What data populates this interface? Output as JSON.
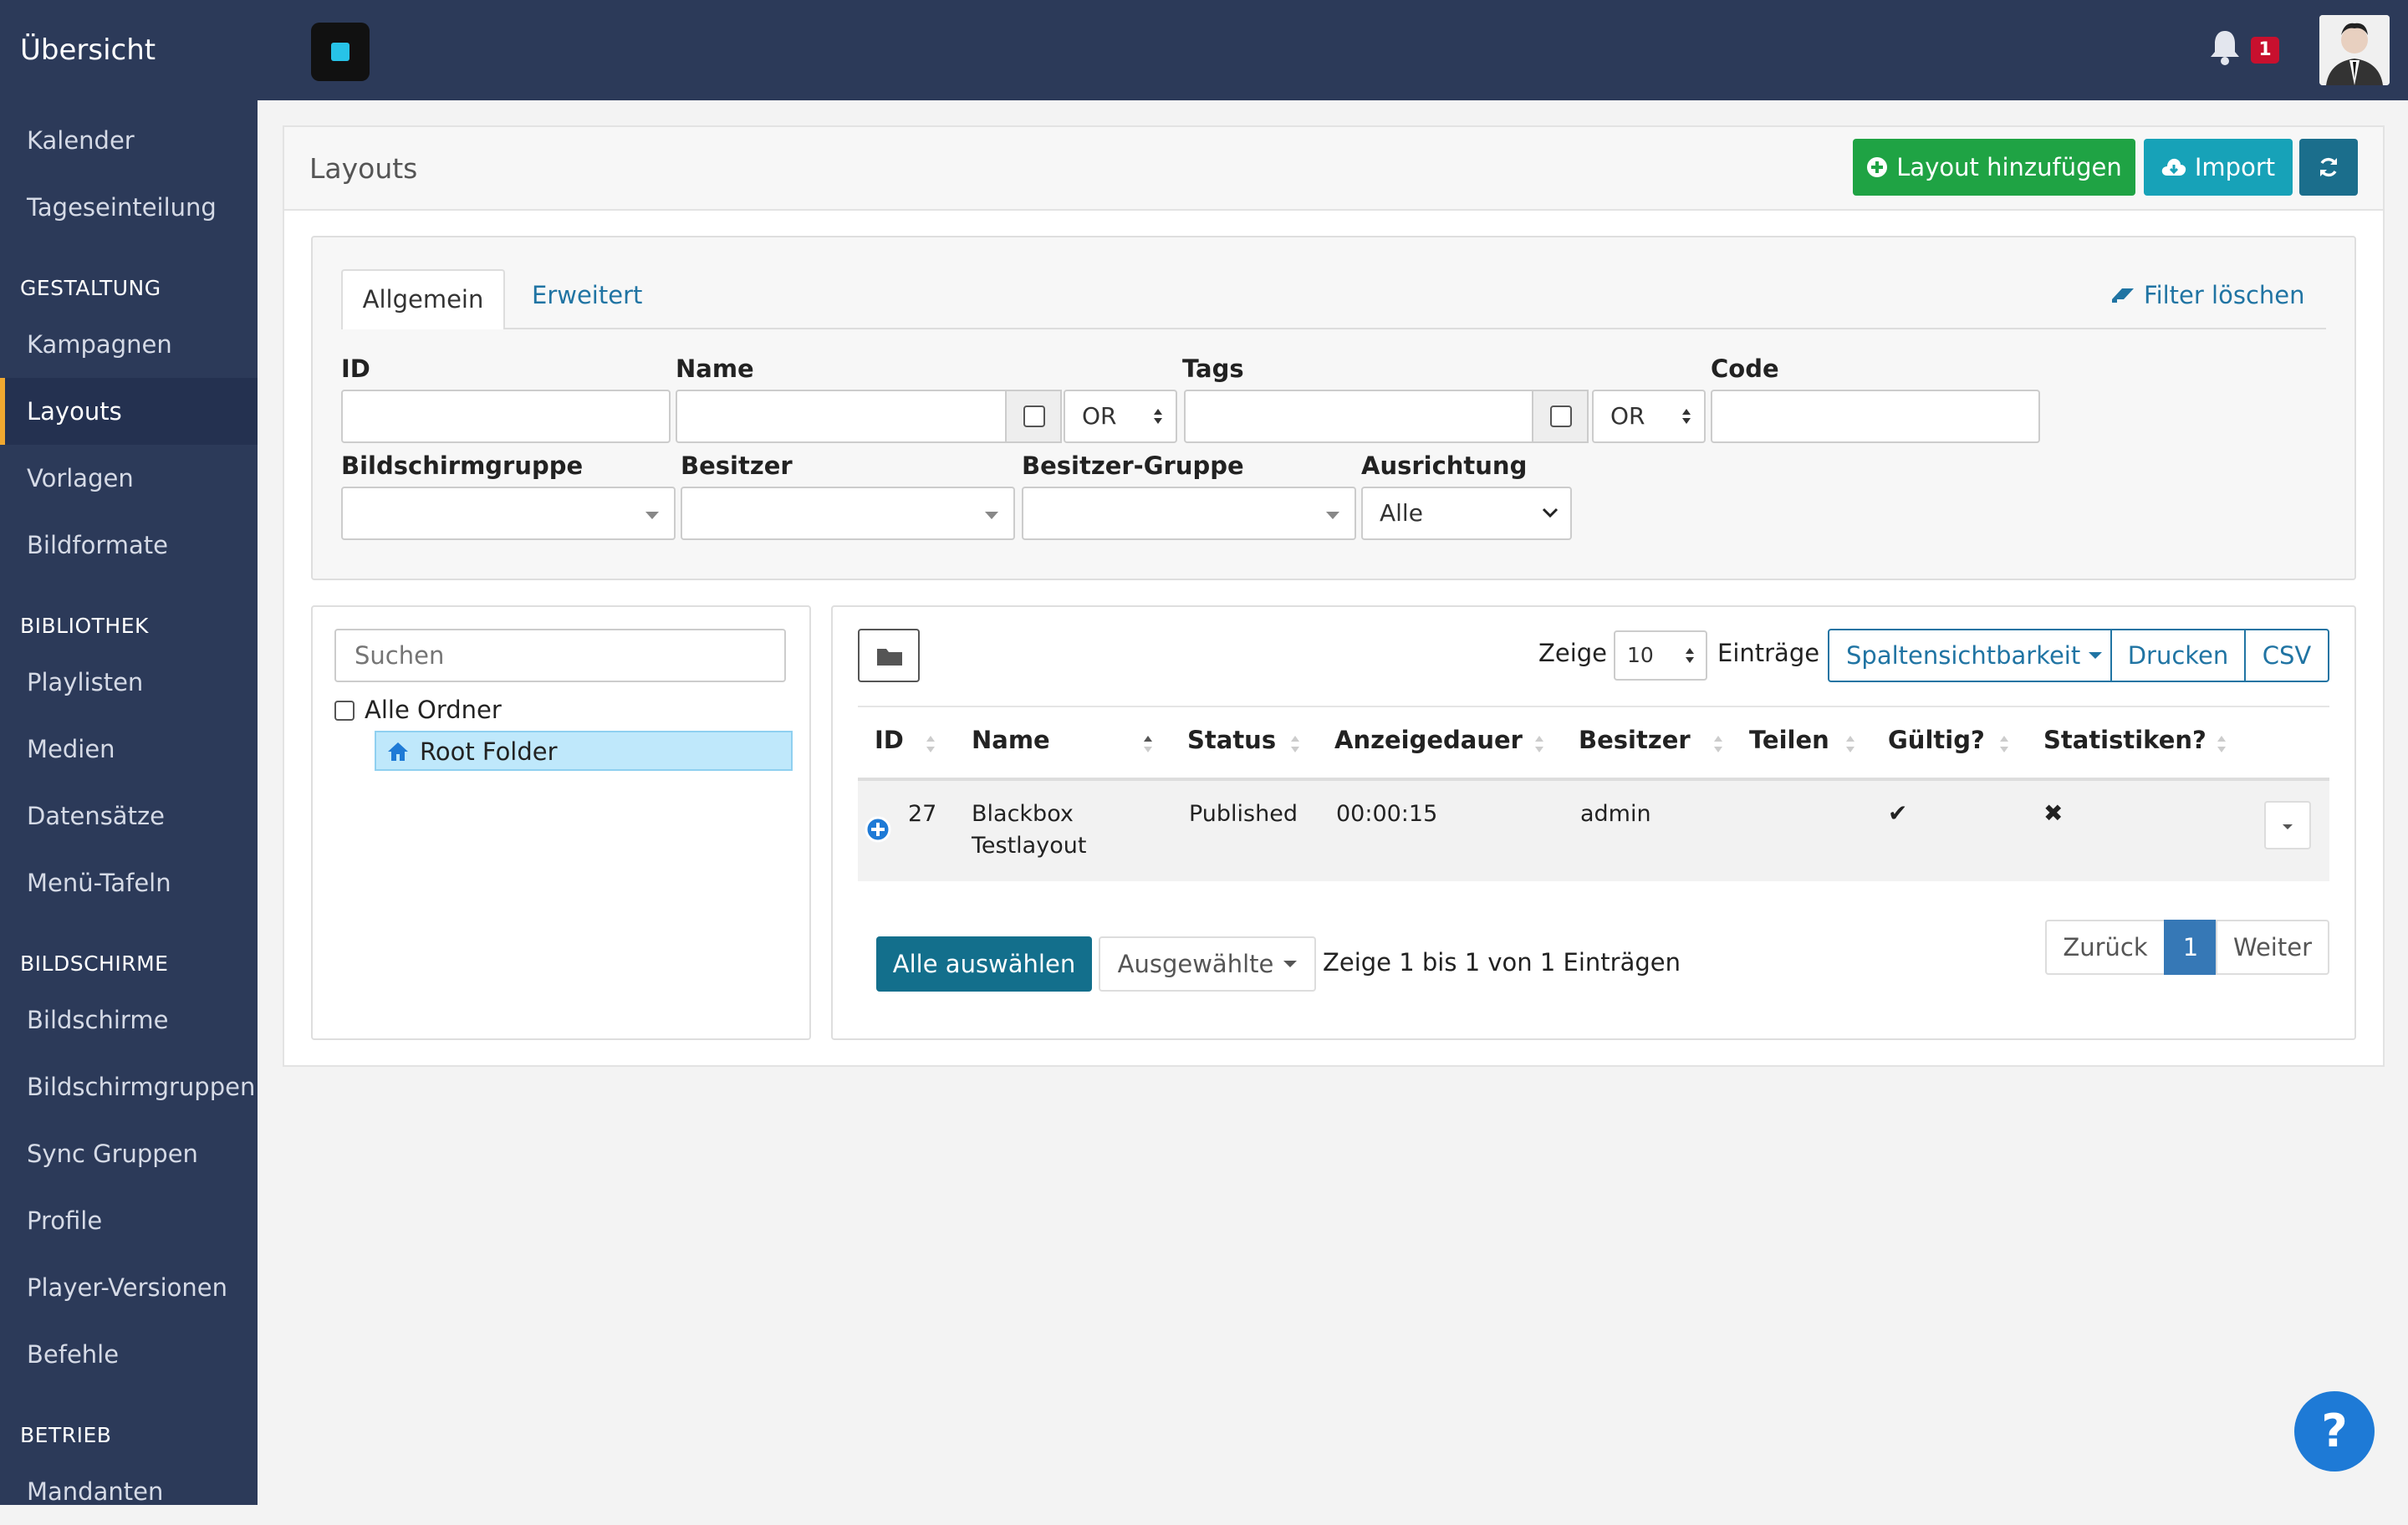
{
  "topbar": {
    "title": "Übersicht",
    "notification_count": "1"
  },
  "sidebar": {
    "top_items": [
      {
        "label": "Kalender"
      },
      {
        "label": "Tageseinteilung"
      }
    ],
    "sections": [
      {
        "heading": "GESTALTUNG",
        "items": [
          {
            "label": "Kampagnen"
          },
          {
            "label": "Layouts",
            "active": true
          },
          {
            "label": "Vorlagen"
          },
          {
            "label": "Bildformate"
          }
        ]
      },
      {
        "heading": "BIBLIOTHEK",
        "items": [
          {
            "label": "Playlisten"
          },
          {
            "label": "Medien"
          },
          {
            "label": "Datensätze"
          },
          {
            "label": "Menü-Tafeln"
          }
        ]
      },
      {
        "heading": "BILDSCHIRME",
        "items": [
          {
            "label": "Bildschirme"
          },
          {
            "label": "Bildschirmgruppen"
          },
          {
            "label": "Sync Gruppen"
          },
          {
            "label": "Profile"
          },
          {
            "label": "Player-Versionen"
          },
          {
            "label": "Befehle"
          }
        ]
      },
      {
        "heading": "BETRIEB",
        "items": [
          {
            "label": "Mandanten"
          }
        ]
      }
    ]
  },
  "page": {
    "title": "Layouts",
    "add_button": "Layout hinzufügen",
    "import_button": "Import"
  },
  "filter": {
    "tabs": [
      {
        "label": "Allgemein",
        "active": true
      },
      {
        "label": "Erweitert"
      }
    ],
    "clear_label": "Filter löschen",
    "fields": {
      "id": {
        "label": "ID",
        "value": ""
      },
      "name": {
        "label": "Name",
        "value": "",
        "logic": "OR"
      },
      "tags": {
        "label": "Tags",
        "value": "",
        "logic": "OR"
      },
      "code": {
        "label": "Code",
        "value": ""
      },
      "display_group": {
        "label": "Bildschirmgruppe",
        "value": ""
      },
      "owner": {
        "label": "Besitzer",
        "value": ""
      },
      "owner_group": {
        "label": "Besitzer-Gruppe",
        "value": ""
      },
      "orientation": {
        "label": "Ausrichtung",
        "value": "Alle"
      }
    }
  },
  "folders": {
    "search_placeholder": "Suchen",
    "all_folders_label": "Alle Ordner",
    "root_folder_label": "Root Folder"
  },
  "table": {
    "show_label": "Zeige",
    "page_size": "10",
    "entries_label": "Einträge",
    "buttons": {
      "column_visibility": "Spaltensichtbarkeit",
      "print": "Drucken",
      "csv": "CSV"
    },
    "columns": [
      "ID",
      "Name",
      "Status",
      "Anzeigedauer",
      "Besitzer",
      "Teilen",
      "Gültig?",
      "Statistiken?"
    ],
    "rows": [
      {
        "id": "27",
        "name_line1": "Blackbox",
        "name_line2": "Testlayout",
        "status": "Published",
        "duration": "00:00:15",
        "owner": "admin",
        "share": "",
        "valid": "✔",
        "stats": "✖"
      }
    ],
    "select_all": "Alle auswählen",
    "selected_menu": "Ausgewählte",
    "info": "Zeige 1 bis 1 von 1 Einträgen",
    "pagination": {
      "prev": "Zurück",
      "current": "1",
      "next": "Weiter"
    }
  },
  "colors": {
    "sidebar": "#2c3a59",
    "add": "#1fa344",
    "import": "#17a2b8",
    "refresh": "#1b6e8c",
    "accent_link": "#2074a3",
    "active_page": "#3678b6"
  },
  "help_label": "?"
}
